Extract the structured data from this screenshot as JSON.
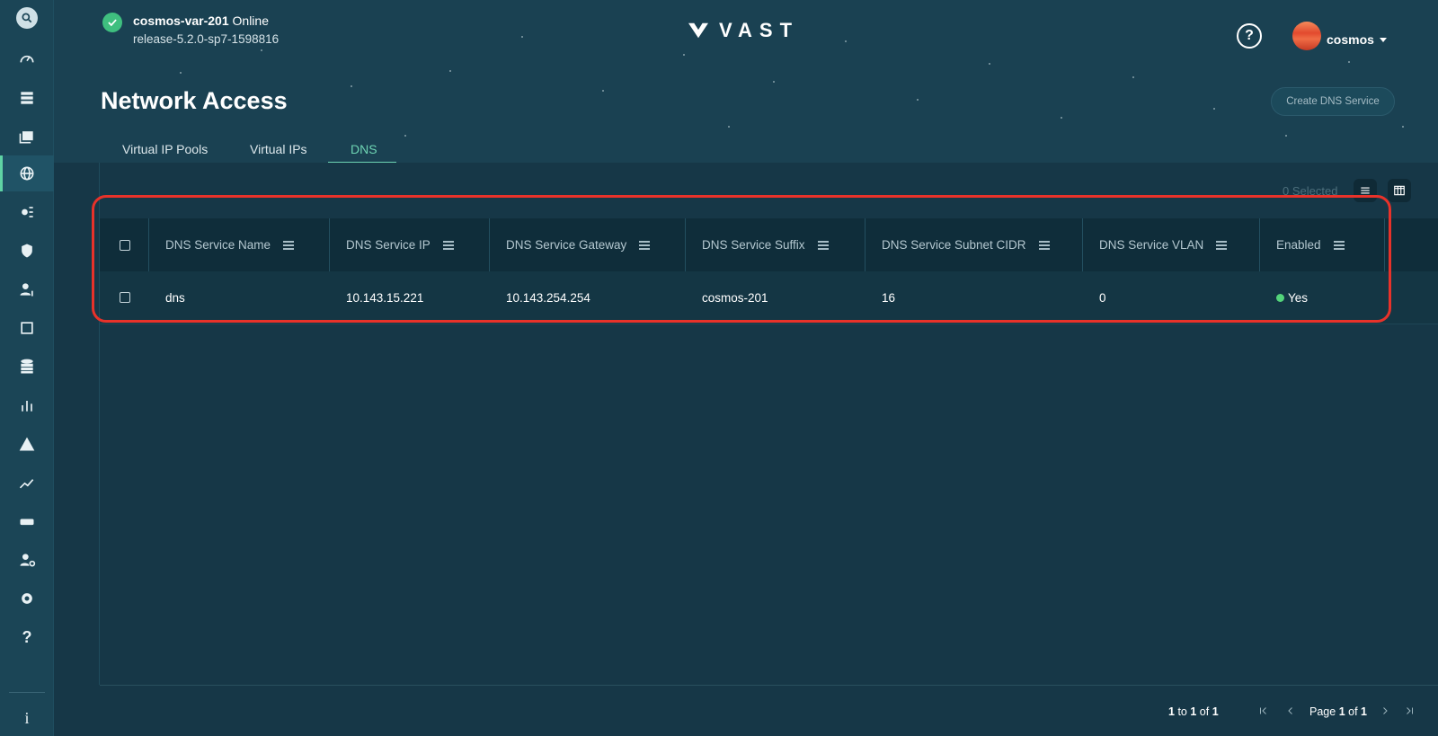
{
  "cluster": {
    "name": "cosmos-var-201",
    "status": "Online",
    "release": "release-5.2.0-sp7-1598816"
  },
  "brand": {
    "logo_text": "VAST"
  },
  "user": {
    "name": "cosmos"
  },
  "page": {
    "title": "Network Access",
    "create_button": "Create DNS Service",
    "tabs": [
      {
        "label": "Virtual IP Pools"
      },
      {
        "label": "Virtual IPs"
      },
      {
        "label": "DNS"
      }
    ],
    "active_tab": "DNS"
  },
  "toolbar": {
    "selected_text": "0 Selected"
  },
  "table": {
    "columns": [
      "DNS Service Name",
      "DNS Service IP",
      "DNS Service Gateway",
      "DNS Service Suffix",
      "DNS Service Subnet CIDR",
      "DNS Service VLAN",
      "Enabled"
    ],
    "rows": [
      {
        "name": "dns",
        "ip": "10.143.15.221",
        "gateway": "10.143.254.254",
        "suffix": "cosmos-201",
        "subnet_cidr": "16",
        "vlan": "0",
        "enabled": "Yes"
      }
    ]
  },
  "pagination": {
    "range_start": "1",
    "range_to": "to",
    "range_end": "1",
    "range_of": "of",
    "total": "1",
    "page_label": "Page",
    "page_current": "1",
    "page_of": "of",
    "page_total": "1"
  },
  "colors": {
    "accent": "#6ed4b3",
    "status_ok": "#3fbf7f",
    "highlight": "#e8322a"
  }
}
